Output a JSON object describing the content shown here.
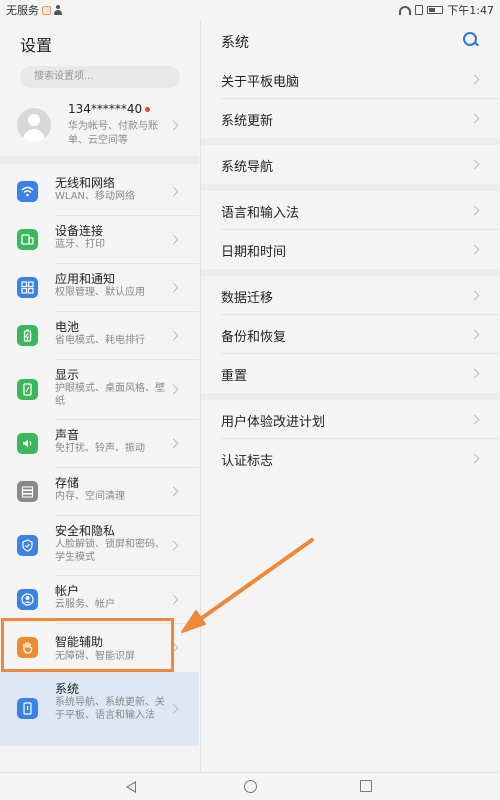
{
  "status_bar": {
    "carrier": "无服务",
    "time": "下午1:47"
  },
  "left_panel": {
    "title": "设置",
    "search_placeholder": "搜索设置项...",
    "account": {
      "name": "134******40",
      "subtitle": "华为帐号、付款与账单、云空间等"
    },
    "items": [
      {
        "label": "无线和网络",
        "sub": "WLAN、移动网络",
        "icon": "wifi-icon",
        "color": "#3b82e6"
      },
      {
        "label": "设备连接",
        "sub": "蓝牙、打印",
        "icon": "device-connection-icon",
        "color": "#3cb85c"
      },
      {
        "label": "应用和通知",
        "sub": "权限管理、默认应用",
        "icon": "apps-icon",
        "color": "#3b82e6"
      },
      {
        "label": "电池",
        "sub": "省电模式、耗电排行",
        "icon": "battery-icon",
        "color": "#3cb85c"
      },
      {
        "label": "显示",
        "sub": "护眼模式、桌面风格、壁纸",
        "icon": "display-icon",
        "color": "#3cb85c"
      },
      {
        "label": "声音",
        "sub": "免打扰、铃声、振动",
        "icon": "sound-icon",
        "color": "#3cb85c"
      },
      {
        "label": "存储",
        "sub": "内存、空间清理",
        "icon": "storage-icon",
        "color": "#8a8a8a"
      },
      {
        "label": "安全和隐私",
        "sub": "人脸解锁、锁屏和密码、学生模式",
        "icon": "shield-icon",
        "color": "#3b82e6"
      },
      {
        "label": "帐户",
        "sub": "云服务、帐户",
        "icon": "account-icon",
        "color": "#3b82e6"
      },
      {
        "label": "智能辅助",
        "sub": "无障碍、智能识屏",
        "icon": "hand-icon",
        "color": "#f08a2a"
      },
      {
        "label": "系统",
        "sub": "系统导航、系统更新、关于平板、语言和输入法",
        "icon": "system-icon",
        "color": "#3b82e6"
      }
    ]
  },
  "right_panel": {
    "title": "系统",
    "groups": [
      [
        "关于平板电脑",
        "系统更新"
      ],
      [
        "系统导航"
      ],
      [
        "语言和输入法",
        "日期和时间"
      ],
      [
        "数据迁移",
        "备份和恢复",
        "重置"
      ],
      [
        "用户体验改进计划",
        "认证标志"
      ]
    ]
  },
  "colors": {
    "accent": "#2a7ad4",
    "highlight": "#f0883a",
    "active_bg": "#dde8f4"
  }
}
